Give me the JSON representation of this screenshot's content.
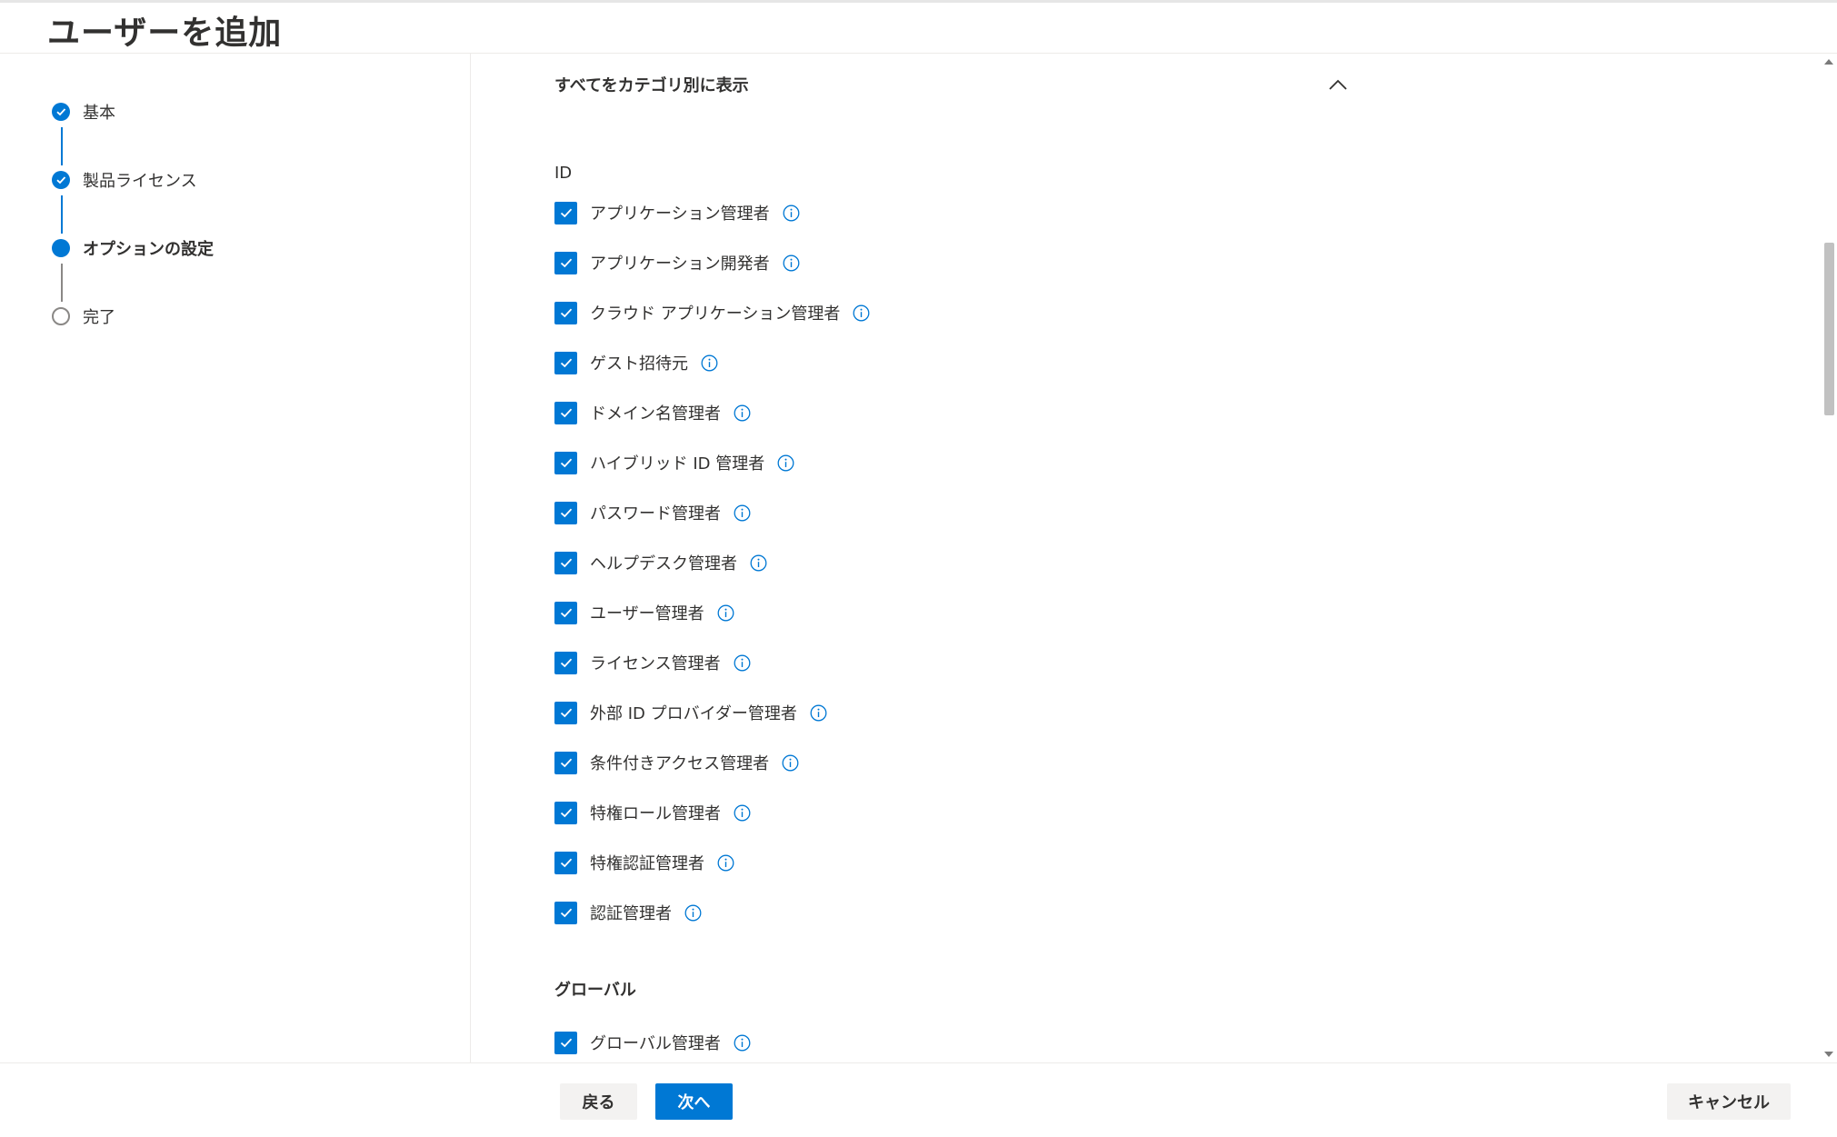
{
  "header": {
    "title": "ユーザーを追加"
  },
  "steps": [
    {
      "label": "基本",
      "state": "done"
    },
    {
      "label": "製品ライセンス",
      "state": "done"
    },
    {
      "label": "オプションの設定",
      "state": "current"
    },
    {
      "label": "完了",
      "state": "todo"
    }
  ],
  "section": {
    "title": "すべてをカテゴリ別に表示",
    "expanded": true
  },
  "groups": [
    {
      "label": "ID",
      "roles": [
        {
          "label": "アプリケーション管理者",
          "checked": true
        },
        {
          "label": "アプリケーション開発者",
          "checked": true
        },
        {
          "label": "クラウド アプリケーション管理者",
          "checked": true
        },
        {
          "label": "ゲスト招待元",
          "checked": true
        },
        {
          "label": "ドメイン名管理者",
          "checked": true
        },
        {
          "label": "ハイブリッド ID 管理者",
          "checked": true
        },
        {
          "label": "パスワード管理者",
          "checked": true
        },
        {
          "label": "ヘルプデスク管理者",
          "checked": true
        },
        {
          "label": "ユーザー管理者",
          "checked": true
        },
        {
          "label": "ライセンス管理者",
          "checked": true
        },
        {
          "label": "外部 ID プロバイダー管理者",
          "checked": true
        },
        {
          "label": "条件付きアクセス管理者",
          "checked": true
        },
        {
          "label": "特権ロール管理者",
          "checked": true
        },
        {
          "label": "特権認証管理者",
          "checked": true
        },
        {
          "label": "認証管理者",
          "checked": true
        }
      ]
    },
    {
      "label": "グローバル",
      "roles": [
        {
          "label": "グローバル管理者",
          "checked": true
        }
      ]
    }
  ],
  "footer": {
    "back_label": "戻る",
    "next_label": "次へ",
    "cancel_label": "キャンセル"
  },
  "colors": {
    "accent": "#0078d4",
    "text": "#323130",
    "secondary_button": "#f3f2f1"
  }
}
